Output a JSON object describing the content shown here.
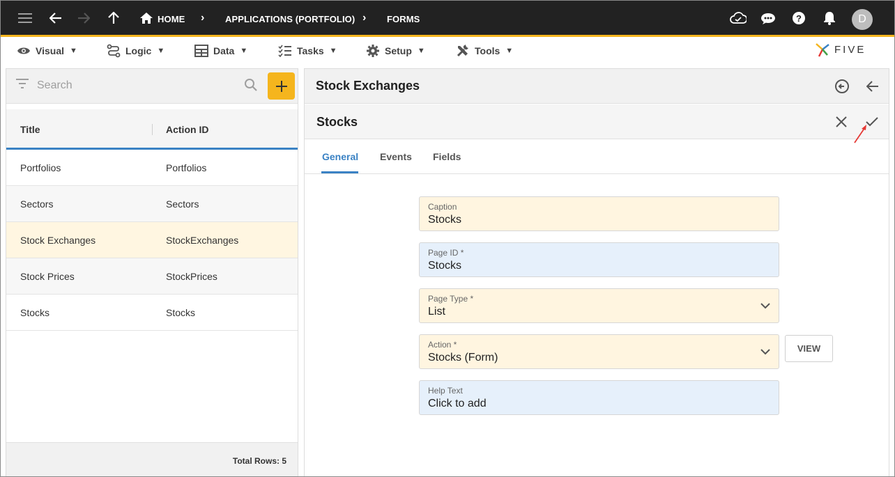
{
  "topbar": {
    "home_label": "HOME",
    "crumbs": [
      "APPLICATIONS (PORTFOLIO)",
      "FORMS"
    ],
    "avatar_letter": "D"
  },
  "menu": {
    "items": [
      {
        "label": "Visual",
        "icon": "eye-icon"
      },
      {
        "label": "Logic",
        "icon": "logic-icon"
      },
      {
        "label": "Data",
        "icon": "table-icon"
      },
      {
        "label": "Tasks",
        "icon": "tasks-icon"
      },
      {
        "label": "Setup",
        "icon": "gear-icon"
      },
      {
        "label": "Tools",
        "icon": "tools-icon"
      }
    ],
    "caret": "▼",
    "logo_text": "FIVE"
  },
  "list": {
    "search_placeholder": "Search",
    "columns": [
      "Title",
      "Action ID"
    ],
    "rows": [
      {
        "title": "Portfolios",
        "action_id": "Portfolios"
      },
      {
        "title": "Sectors",
        "action_id": "Sectors"
      },
      {
        "title": "Stock Exchanges",
        "action_id": "StockExchanges"
      },
      {
        "title": "Stock Prices",
        "action_id": "StockPrices"
      },
      {
        "title": "Stocks",
        "action_id": "Stocks"
      }
    ],
    "selected_row": "Stock Exchanges",
    "total_rows": "Total Rows: 5"
  },
  "detail": {
    "title": "Stock Exchanges",
    "sub_title": "Stocks",
    "tabs": [
      "General",
      "Events",
      "Fields"
    ],
    "active_tab": "General",
    "fields": {
      "caption": {
        "label": "Caption",
        "value": "Stocks"
      },
      "page_id": {
        "label": "Page ID *",
        "value": "Stocks"
      },
      "page_type": {
        "label": "Page Type *",
        "value": "List"
      },
      "action": {
        "label": "Action *",
        "value": "Stocks (Form)"
      },
      "help_text": {
        "label": "Help Text",
        "value": "Click to add"
      }
    },
    "view_button": "VIEW"
  },
  "colors": {
    "topbar": "#222222",
    "accent": "#f5b51d",
    "tab_active": "#3a82c4",
    "selected_row": "#fff6e1",
    "field_yellow": "#fff5e0",
    "field_blue": "#e6f0fb",
    "annotation_arrow": "#e53935"
  }
}
